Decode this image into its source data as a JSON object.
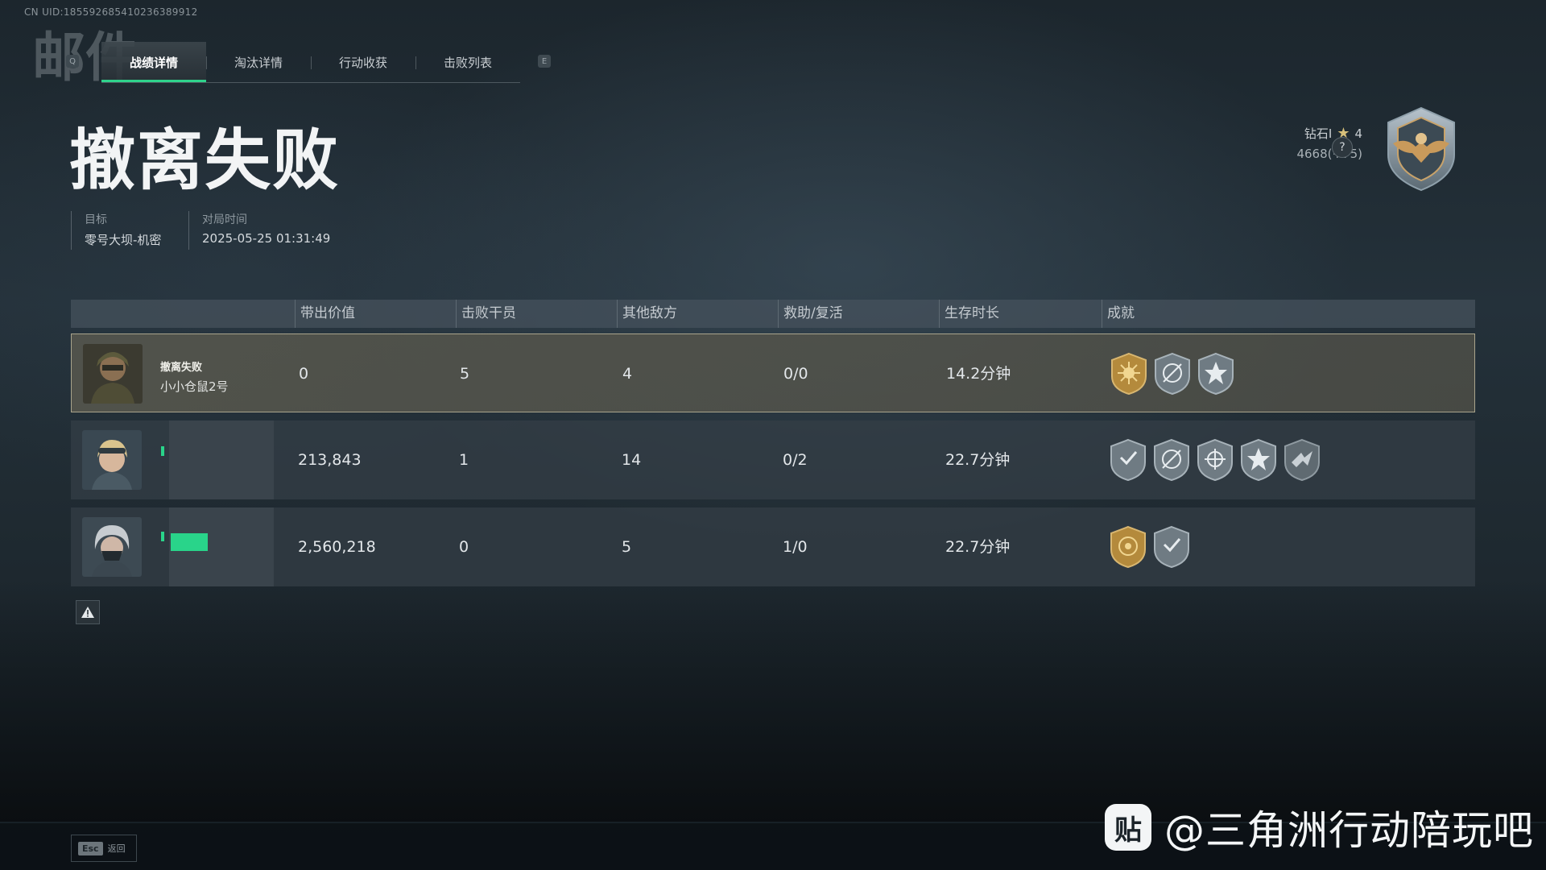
{
  "uid": "CN UID:185592685410236389912",
  "watermark_top": "邮件",
  "tabs": [
    {
      "label": "战绩详情",
      "active": true
    },
    {
      "label": "淘汰详情",
      "active": false
    },
    {
      "label": "行动收获",
      "active": false
    },
    {
      "label": "击败列表",
      "active": false
    }
  ],
  "tab_keys": {
    "left": "Q",
    "right": "E"
  },
  "result_title": "撤离失败",
  "meta": {
    "target_label": "目标",
    "target_value": "零号大坝-机密",
    "time_label": "对局时间",
    "time_value": "2025-05-25 01:31:49"
  },
  "rank": {
    "tier": "钻石I",
    "stars": "4",
    "points": "4668(+75)",
    "help": "?"
  },
  "table": {
    "headers": [
      "带出价值",
      "击败干员",
      "其他敌方",
      "救助/复活",
      "生存时长",
      "成就"
    ],
    "rows": [
      {
        "status": "撤离失败",
        "name": "小小仓鼠2号",
        "value": "0",
        "kills": "5",
        "other": "4",
        "assist": "0/0",
        "time": "14.2分钟",
        "achievements": [
          "gold-sun-badge-icon",
          "compass-badge-icon",
          "star-burst-badge-icon"
        ]
      },
      {
        "status": "",
        "name": "",
        "value": "213,843",
        "kills": "1",
        "other": "14",
        "assist": "0/2",
        "time": "22.7分钟",
        "achievements": [
          "check-shield-badge-icon",
          "compass-badge-icon",
          "cross-badge-icon",
          "star-burst-badge-icon",
          "wing-badge-icon"
        ]
      },
      {
        "status": "",
        "name": "",
        "value": "2,560,218",
        "kills": "0",
        "other": "5",
        "assist": "1/0",
        "time": "22.7分钟",
        "achievements": [
          "gold-target-badge-icon",
          "check-shield-badge-icon"
        ]
      }
    ]
  },
  "esc": {
    "key": "Esc",
    "label": "返回"
  },
  "watermark": {
    "logo": "贴",
    "text": "@三角洲行动陪玩吧"
  }
}
